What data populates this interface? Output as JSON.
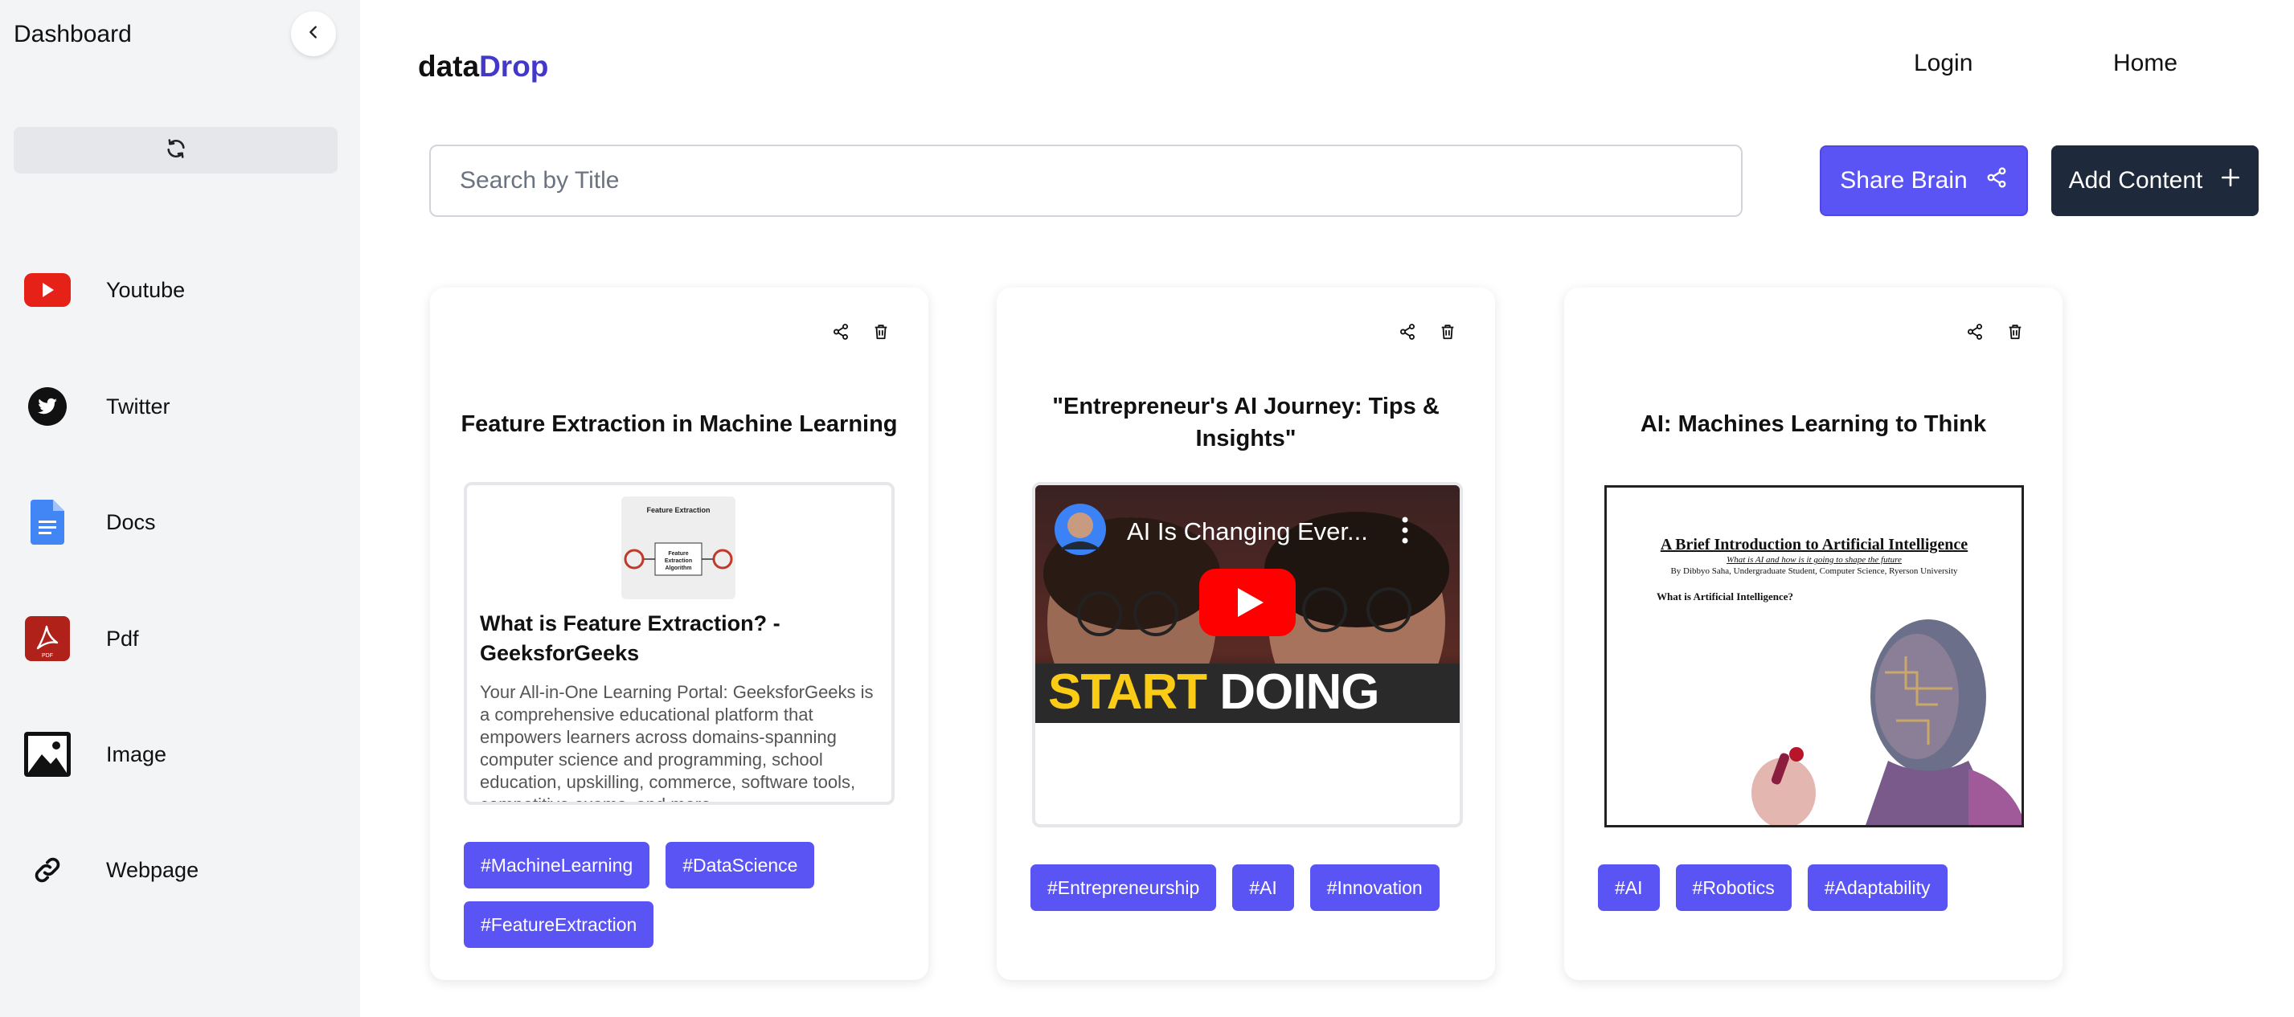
{
  "sidebar": {
    "title": "Dashboard",
    "items": [
      {
        "label": "Youtube",
        "icon": "youtube-icon"
      },
      {
        "label": "Twitter",
        "icon": "twitter-icon"
      },
      {
        "label": "Docs",
        "icon": "docs-icon"
      },
      {
        "label": "Pdf",
        "icon": "pdf-icon"
      },
      {
        "label": "Image",
        "icon": "image-icon"
      },
      {
        "label": "Webpage",
        "icon": "link-icon"
      }
    ]
  },
  "header": {
    "brand_part1": "data",
    "brand_part2": "Drop",
    "nav": [
      "Login",
      "Home"
    ]
  },
  "search": {
    "placeholder": "Search by Title",
    "value": ""
  },
  "actions": {
    "share_label": "Share Brain",
    "add_label": "Add Content"
  },
  "cards": [
    {
      "title": "Feature Extraction in Machine Learning",
      "type": "webpage",
      "preview": {
        "thumb_caption": "Feature Extraction",
        "thumb_center": "Feature Extraction Algorithm",
        "title": "What is Feature Extraction? - GeeksforGeeks",
        "description": "Your All-in-One Learning Portal: GeeksforGeeks is a comprehensive educational platform that empowers learners across domains-spanning computer science and programming, school education, upskilling, commerce, software tools, competitive exams, and more."
      },
      "tags": [
        "#MachineLearning",
        "#DataScience",
        "#FeatureExtraction"
      ]
    },
    {
      "title": "\"Entrepreneur's AI Journey: Tips & Insights\"",
      "type": "youtube",
      "video": {
        "title": "AI Is Changing Ever...",
        "banner_yellow": "START",
        "banner_white": "DOING THIS!"
      },
      "tags": [
        "#Entrepreneurship",
        "#AI",
        "#Innovation"
      ]
    },
    {
      "title": "AI: Machines Learning to Think",
      "type": "pdf",
      "document": {
        "title": "A Brief Introduction to Artificial Intelligence",
        "subtitle": "What is AI and how is it going to shape the future",
        "author": "By Dibbyo Saha, Undergraduate Student, Computer Science, Ryerson University",
        "question": "What is Artificial Intelligence?"
      },
      "tags": [
        "#AI",
        "#Robotics",
        "#Adaptability"
      ]
    }
  ],
  "colors": {
    "accent": "#5b54f5",
    "brand": "#4338ca",
    "dark_button": "#1e293b",
    "sidebar_bg": "#f3f4f6"
  }
}
